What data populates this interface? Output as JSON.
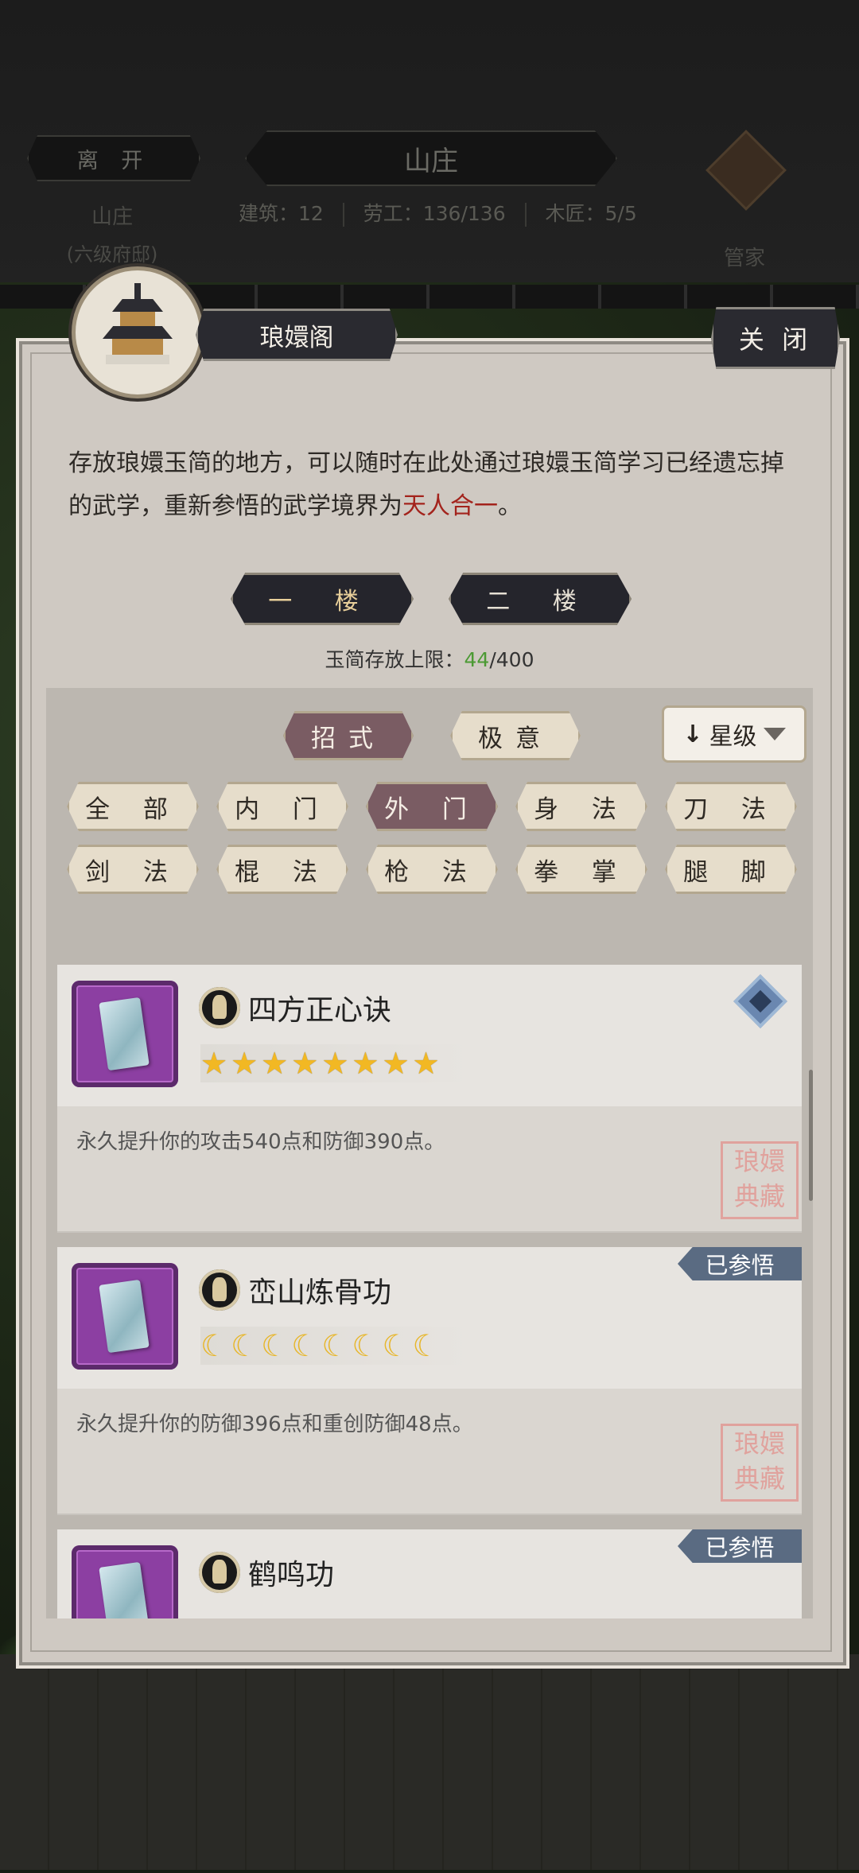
{
  "header": {
    "leave_label": "离 开",
    "title": "山庄",
    "location_name": "山庄",
    "location_level": "(六级府邸)",
    "stats": [
      {
        "label": "建筑：",
        "value": "12"
      },
      {
        "label": "劳工：",
        "value": "136/136"
      },
      {
        "label": "木匠：",
        "value": "5/5"
      }
    ],
    "steward_label": "管家"
  },
  "panel": {
    "title": "琅嬛阁",
    "close_label": "关 闭",
    "description": "存放琅嬛玉简的地方，可以随时在此处通过琅嬛玉简学习已经遗忘掉的武学，重新参悟的武学境界为",
    "description_highlight": "天人合一",
    "description_end": "。",
    "floors": [
      {
        "label": "一 楼",
        "active": true
      },
      {
        "label": "二 楼",
        "active": false
      }
    ],
    "capacity_label": "玉简存放上限：",
    "capacity_current": "44",
    "capacity_max": "/400"
  },
  "filters": {
    "type_tabs": [
      {
        "label": "招式",
        "active": true
      },
      {
        "label": "极意",
        "active": false
      }
    ],
    "sort": {
      "label": "星级",
      "arrow": "↓"
    },
    "categories_row1": [
      {
        "label": "全 部",
        "active": false
      },
      {
        "label": "内 门",
        "active": false
      },
      {
        "label": "外 门",
        "active": true
      },
      {
        "label": "身 法",
        "active": false
      },
      {
        "label": "刀 法",
        "active": false
      }
    ],
    "categories_row2": [
      {
        "label": "剑 法",
        "active": false
      },
      {
        "label": "棍 法",
        "active": false
      },
      {
        "label": "枪 法",
        "active": false
      },
      {
        "label": "拳 掌",
        "active": false
      },
      {
        "label": "腿 脚",
        "active": false
      }
    ]
  },
  "skills": [
    {
      "name": "四方正心诀",
      "rating": "8 stars",
      "description": "永久提升你的攻击540点和防御390点。",
      "badge": "",
      "seal": "琅嬛\n典藏"
    },
    {
      "name": "峦山炼骨功",
      "rating": "8 moons",
      "description": "永久提升你的防御396点和重创防御48点。",
      "badge": "已参悟",
      "seal": "琅嬛\n典藏"
    },
    {
      "name": "鹤鸣功",
      "badge": "已参悟"
    }
  ],
  "colors": {
    "highlight": "#a3231c",
    "capacity_current": "#4c9a34",
    "active_pill": "#7a5c63",
    "badge": "#5a6b82",
    "star": "#f2b823"
  }
}
